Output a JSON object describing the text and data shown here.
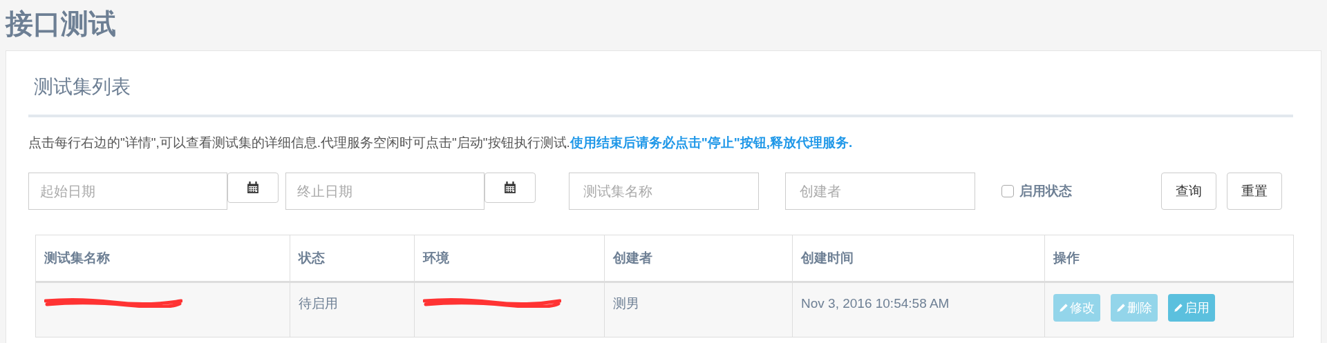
{
  "page_title": "接口测试",
  "panel": {
    "title": "测试集列表",
    "notice": {
      "text": "点击每行右边的\"详情\",可以查看测试集的详细信息.代理服务空闲时可点击\"启动\"按钮执行测试.",
      "highlight": "使用结束后请务必点击\"停止\"按钮,释放代理服务."
    },
    "filters": [
      {
        "kind": "date",
        "placeholder": "起始日期"
      },
      {
        "kind": "date",
        "placeholder": "终止日期"
      },
      {
        "kind": "text",
        "placeholder": "测试集名称"
      },
      {
        "kind": "text",
        "placeholder": "创建者"
      },
      {
        "kind": "checkbox",
        "label": "启用状态",
        "checked": false
      }
    ],
    "buttons": [
      "查询",
      "重置"
    ],
    "table": {
      "columns": [
        "测试集名称",
        "状态",
        "环境",
        "创建者",
        "创建时间",
        "操作"
      ],
      "rows": [
        {
          "cells": [
            {
              "redacted": true
            },
            {
              "text": "待启用",
              "redacted": false
            },
            {
              "redacted": true
            },
            {
              "text": "测男",
              "redacted": false
            },
            {
              "text": "Nov 3, 2016 10:54:58 AM",
              "redacted": false
            }
          ],
          "actions": [
            {
              "label": "修改",
              "disabled": true
            },
            {
              "label": "删除",
              "disabled": true
            },
            {
              "label": "启用",
              "disabled": false
            }
          ]
        }
      ]
    }
  }
}
